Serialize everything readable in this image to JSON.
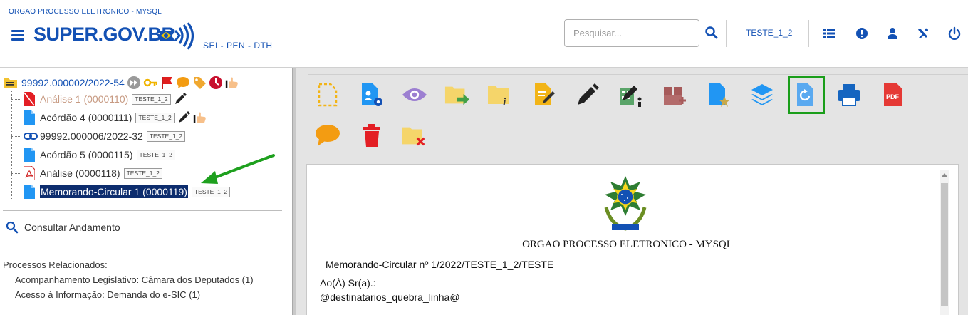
{
  "header": {
    "org_name": "ORGAO PROCESSO ELETRONICO - MYSQL",
    "logo_text": "SUPER.GOV.BR",
    "subtitle": "SEI - PEN - DTH",
    "search_placeholder": "Pesquisar...",
    "unit": "TESTE_1_2",
    "icons": [
      "menu-icon",
      "search-icon",
      "unit-list-icon",
      "alert-icon",
      "user-icon",
      "tools-icon",
      "power-icon"
    ]
  },
  "tree": {
    "root": "99992.000002/2022-54",
    "items": [
      {
        "label": "Análise 1 (0000110)",
        "badge": "TESTE_1_2"
      },
      {
        "label": "Acórdão 4 (0000111)",
        "badge": "TESTE_1_2"
      },
      {
        "label": "99992.000006/2022-32",
        "badge": "TESTE_1_2"
      },
      {
        "label": "Acórdão 5 (0000115)",
        "badge": "TESTE_1_2"
      },
      {
        "label": "Análise (0000118)",
        "badge": "TESTE_1_2"
      },
      {
        "label": "Memorando-Circular 1 (0000119)",
        "badge": "TESTE_1_2"
      }
    ]
  },
  "consult": "Consultar Andamento",
  "related": {
    "title": "Processos Relacionados:",
    "items": [
      "Acompanhamento Legislativo: Câmara dos Deputados (1)",
      "Acesso à Informação: Demanda do e-SIC (1)"
    ]
  },
  "toolbar": {
    "buttons": [
      "new-document-icon",
      "document-settings-icon",
      "view-icon",
      "send-process-icon",
      "process-info-icon",
      "edit-content-icon",
      "sign-icon",
      "sign-block-icon",
      "add-to-block-icon",
      "favorite-template-icon",
      "layers-icon",
      "reload-icon",
      "print-icon",
      "pdf-icon",
      "comment-icon",
      "delete-icon",
      "cancel-folder-icon"
    ],
    "pdf_text": "PDF"
  },
  "document": {
    "org": "ORGAO PROCESSO ELETRONICO - MYSQL",
    "memo": "Memorando-Circular nº 1/2022/TESTE_1_2/TESTE",
    "to": "Ao(À) Sr(a).:",
    "dest": "@destinatarios_quebra_linha@"
  },
  "colors": {
    "primary": "#1351b4",
    "highlight": "#1a9e1a",
    "selected": "#0d2d6e"
  }
}
